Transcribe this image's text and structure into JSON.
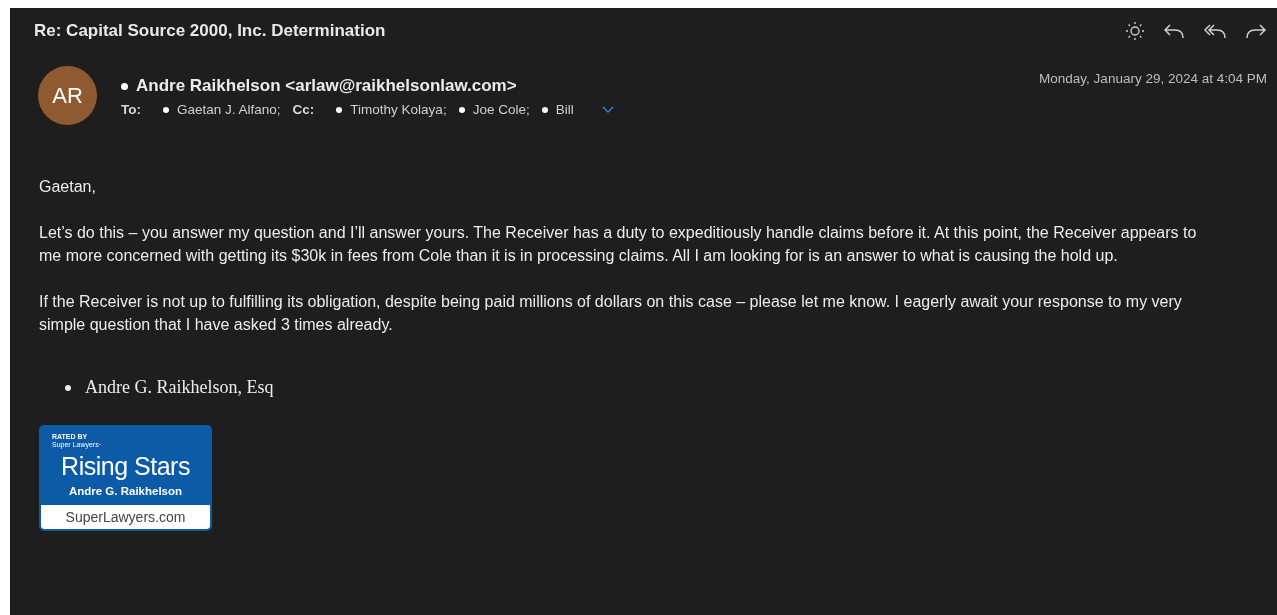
{
  "subject": "Re: Capital Source 2000, Inc. Determination",
  "sender": {
    "initials": "AR",
    "name": "Andre Raikhelson <arlaw@raikhelsonlaw.com>"
  },
  "date": "Monday, January 29, 2024 at 4:04 PM",
  "to_label": "To:",
  "to": [
    "Gaetan J. Alfano;"
  ],
  "cc_label": "Cc:",
  "cc": [
    "Timothy Kolaya;",
    "Joe Cole;",
    "Bill"
  ],
  "body": [
    "Gaetan,",
    "Let’s do this – you answer my question and I’ll answer yours. The Receiver has a duty to expeditiously handle claims before it. At this point, the Receiver appears to me more concerned with getting its $30k in fees from Cole than it is in processing claims. All I am looking for is an answer to what is causing the hold up.",
    "If the Receiver is not up to fulfilling its obligation, despite being paid millions of dollars on this case – please let me know. I eagerly await your response to my very simple question that I have asked 3 times already."
  ],
  "signature": [
    "Andre G. Raikhelson, Esq"
  ],
  "badge": {
    "rated_by": "RATED BY",
    "org": "Super Lawyers·",
    "title": "Rising Stars",
    "name": "Andre G. Raikhelson",
    "site": "SuperLawyers.com"
  }
}
